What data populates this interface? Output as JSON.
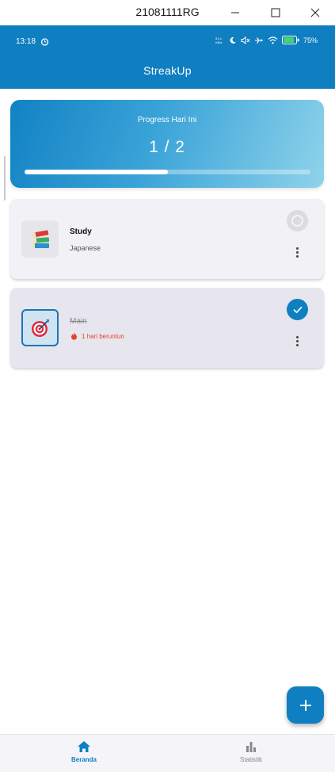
{
  "window": {
    "title": "21081111RG"
  },
  "statusbar": {
    "time": "13:18",
    "network_speed": "91.4 KB/s",
    "battery": "75%"
  },
  "app": {
    "title": "StreakUp"
  },
  "progress": {
    "label": "Progress Hari Ini",
    "count_text": "1 / 2",
    "completed": 1,
    "total": 2,
    "fraction": 0.5
  },
  "habits": [
    {
      "name": "Study",
      "subtitle": "Japanese",
      "icon": "books-icon",
      "completed": false
    },
    {
      "name": "Main",
      "streak": "1 hari beruntun",
      "icon": "target-icon",
      "completed": true
    }
  ],
  "bottom_nav": {
    "home_label": "Beranda",
    "stats_label": "Statistik"
  },
  "colors": {
    "primary": "#0f7fc1",
    "streak": "#e0442a",
    "card_bg": "#f1f1f6"
  }
}
